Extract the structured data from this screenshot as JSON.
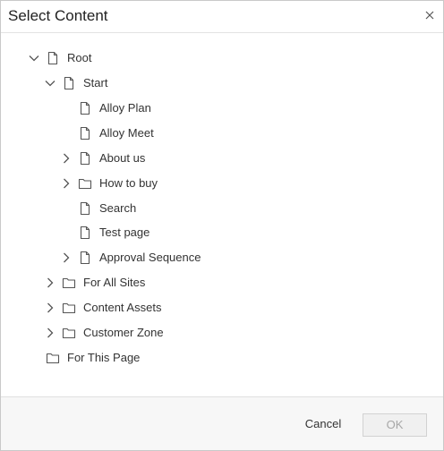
{
  "dialog": {
    "title": "Select Content",
    "close_icon": "close-icon"
  },
  "tree": {
    "nodes": [
      {
        "label": "Root",
        "icon": "page-icon",
        "expander": "expanded"
      },
      {
        "label": "Start",
        "icon": "page-icon",
        "expander": "expanded"
      },
      {
        "label": "Alloy Plan",
        "icon": "page-icon",
        "expander": "none"
      },
      {
        "label": "Alloy Meet",
        "icon": "page-icon",
        "expander": "none"
      },
      {
        "label": "About us",
        "icon": "page-icon",
        "expander": "collapsed"
      },
      {
        "label": "How to buy",
        "icon": "folder-icon",
        "expander": "collapsed"
      },
      {
        "label": "Search",
        "icon": "page-icon",
        "expander": "none"
      },
      {
        "label": "Test page",
        "icon": "page-icon",
        "expander": "none"
      },
      {
        "label": "Approval Sequence",
        "icon": "page-icon",
        "expander": "collapsed"
      },
      {
        "label": "For All Sites",
        "icon": "folder-icon",
        "expander": "collapsed"
      },
      {
        "label": "Content Assets",
        "icon": "folder-icon",
        "expander": "collapsed"
      },
      {
        "label": "Customer Zone",
        "icon": "folder-icon",
        "expander": "collapsed"
      },
      {
        "label": "For This Page",
        "icon": "folder-icon",
        "expander": "none"
      }
    ]
  },
  "footer": {
    "cancel_label": "Cancel",
    "ok_label": "OK"
  }
}
